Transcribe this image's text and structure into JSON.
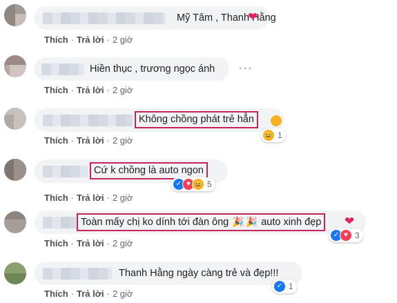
{
  "comments": [
    {
      "text": "Mỹ Tâm , Thanh Hằng",
      "action_like": "Thích",
      "action_reply": "Trả lời",
      "time": "2 giờ",
      "suffix": "❤"
    },
    {
      "text": "Hiền thục , trương ngọc ánh",
      "action_like": "Thích",
      "action_reply": "Trả lời",
      "time": "2 giờ",
      "more": "···"
    },
    {
      "text": "Không chồng phát trẻ hẳn",
      "action_like": "Thích",
      "action_reply": "Trả lời",
      "time": "2 giờ",
      "reaction_count": "1"
    },
    {
      "text": "Cứ k chồng là auto ngon",
      "action_like": "Thích",
      "action_reply": "Trả lời",
      "time": "2 giờ",
      "reaction_count": "5"
    },
    {
      "text_a": "Toàn mấy chị ko dính tới đàn ông",
      "text_b": "auto xinh đẹp",
      "action_like": "Thích",
      "action_reply": "Trả lời",
      "time": "2 giờ",
      "suffix": "❤",
      "reaction_count": "3"
    },
    {
      "text": "Thanh Hằng ngày càng trẻ và đẹp!!!",
      "action_like": "Thích",
      "action_reply": "Trả lời",
      "time": "2 giờ",
      "reaction_count": "1"
    }
  ],
  "separator": "·",
  "icons": {
    "like": "👍",
    "love": "♥",
    "haha": "😆",
    "party": "🎉"
  },
  "colors": {
    "highlight_border": "#c4245a",
    "bubble": "#f2f3f5",
    "like_blue": "#1877f2",
    "love_red": "#f33e58"
  }
}
